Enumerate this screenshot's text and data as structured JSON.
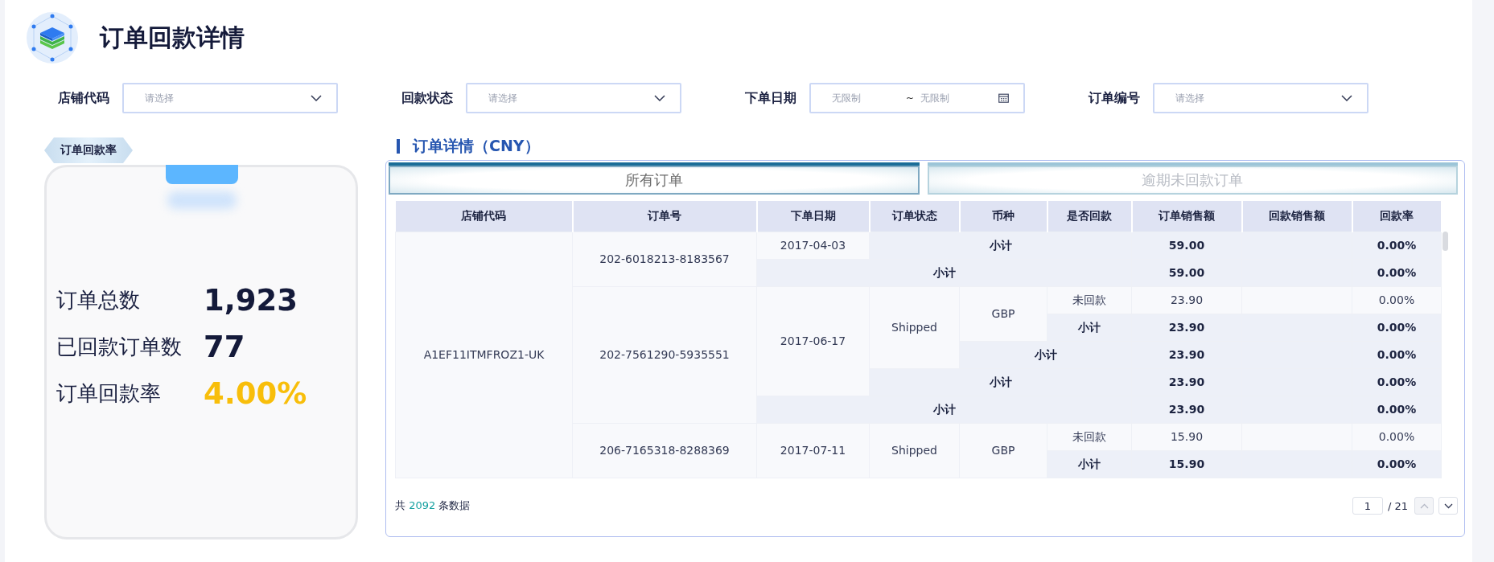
{
  "page_title": "订单回款详情",
  "filters": [
    {
      "label": "店铺代码",
      "kind": "select",
      "placeholder": "请选择"
    },
    {
      "label": "回款状态",
      "kind": "select",
      "placeholder": "请选择"
    },
    {
      "label": "下单日期",
      "kind": "daterange",
      "start_placeholder": "无限制",
      "separator": "~",
      "end_placeholder": "无限制"
    },
    {
      "label": "订单编号",
      "kind": "select",
      "placeholder": "请选择"
    }
  ],
  "summary_card": {
    "badge": "订单回款率",
    "stats": [
      {
        "label": "订单总数",
        "value": "1,923",
        "highlight": false
      },
      {
        "label": "已回款订单数",
        "value": "77",
        "highlight": false
      },
      {
        "label": "订单回款率",
        "value": "4.00%",
        "highlight": true
      }
    ]
  },
  "detail": {
    "title": "订单详情（CNY）",
    "tabs": [
      {
        "label": "所有订单",
        "selected": true
      },
      {
        "label": "逾期未回款订单",
        "selected": false
      }
    ],
    "table": {
      "columns": [
        "店铺代码",
        "订单号",
        "下单日期",
        "订单状态",
        "币种",
        "是否回款",
        "订单销售额",
        "回款销售额",
        "回款率"
      ],
      "rows": [
        [
          {
            "text": "A1EF11ITMFROZ1-UK",
            "rowspan": 9,
            "kind": "data"
          },
          {
            "text": "202-6018213-8183567",
            "rowspan": 2,
            "kind": "data"
          },
          {
            "text": "2017-04-03",
            "kind": "data"
          },
          {
            "text": "小计",
            "colspan": 3,
            "kind": "subtotal"
          },
          {
            "text": "59.00",
            "kind": "subtotal"
          },
          {
            "kind": "subtotal"
          },
          {
            "text": "0.00%",
            "kind": "subtotal"
          }
        ],
        [
          {
            "text": "小计",
            "colspan": 4,
            "kind": "subtotal"
          },
          {
            "text": "59.00",
            "kind": "subtotal"
          },
          {
            "kind": "subtotal"
          },
          {
            "text": "0.00%",
            "kind": "subtotal"
          }
        ],
        [
          {
            "text": "202-7561290-5935551",
            "rowspan": 5,
            "kind": "data"
          },
          {
            "text": "2017-06-17",
            "rowspan": 4,
            "kind": "data"
          },
          {
            "text": "Shipped",
            "rowspan": 3,
            "kind": "data"
          },
          {
            "text": "GBP",
            "rowspan": 2,
            "kind": "data"
          },
          {
            "text": "未回款",
            "kind": "data"
          },
          {
            "text": "23.90",
            "kind": "data"
          },
          {
            "kind": "data"
          },
          {
            "text": "0.00%",
            "kind": "data"
          }
        ],
        [
          {
            "text": "小计",
            "kind": "subtotal"
          },
          {
            "text": "23.90",
            "kind": "subtotal"
          },
          {
            "kind": "subtotal"
          },
          {
            "text": "0.00%",
            "kind": "subtotal"
          }
        ],
        [
          {
            "text": "小计",
            "colspan": 2,
            "kind": "subtotal"
          },
          {
            "text": "23.90",
            "kind": "subtotal"
          },
          {
            "kind": "subtotal"
          },
          {
            "text": "0.00%",
            "kind": "subtotal"
          }
        ],
        [
          {
            "text": "小计",
            "colspan": 3,
            "kind": "subtotal"
          },
          {
            "text": "23.90",
            "kind": "subtotal"
          },
          {
            "kind": "subtotal"
          },
          {
            "text": "0.00%",
            "kind": "subtotal"
          }
        ],
        [
          {
            "text": "小计",
            "colspan": 4,
            "kind": "subtotal"
          },
          {
            "text": "23.90",
            "kind": "subtotal"
          },
          {
            "kind": "subtotal"
          },
          {
            "text": "0.00%",
            "kind": "subtotal"
          }
        ],
        [
          {
            "text": "206-7165318-8288369",
            "rowspan": 2,
            "kind": "data"
          },
          {
            "text": "2017-07-11",
            "rowspan": 2,
            "kind": "data"
          },
          {
            "text": "Shipped",
            "rowspan": 2,
            "kind": "data"
          },
          {
            "text": "GBP",
            "rowspan": 2,
            "kind": "data"
          },
          {
            "text": "未回款",
            "kind": "data"
          },
          {
            "text": "15.90",
            "kind": "data"
          },
          {
            "kind": "data"
          },
          {
            "text": "0.00%",
            "kind": "data"
          }
        ],
        [
          {
            "text": "小计",
            "kind": "subtotal"
          },
          {
            "text": "15.90",
            "kind": "subtotal"
          },
          {
            "kind": "subtotal"
          },
          {
            "text": "0.00%",
            "kind": "subtotal"
          }
        ]
      ]
    },
    "footer": {
      "total_prefix": "共",
      "total_count": "2092",
      "total_suffix": "条数据",
      "page_value": "1",
      "page_total": "/ 21"
    }
  }
}
